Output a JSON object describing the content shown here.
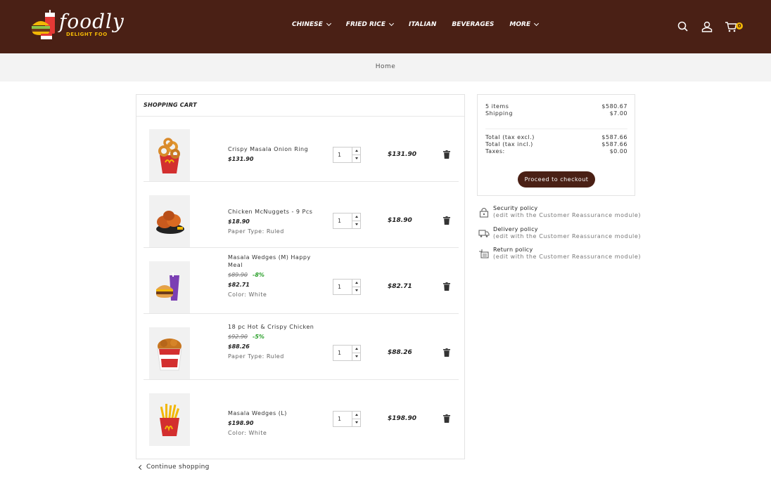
{
  "header": {
    "logo_text": "foodly",
    "logo_sub": "DELIGHT FOO",
    "nav": [
      {
        "label": "CHINESE",
        "has_dropdown": true
      },
      {
        "label": "FRIED RICE",
        "has_dropdown": true
      },
      {
        "label": "ITALIAN",
        "has_dropdown": false
      },
      {
        "label": "BEVERAGES",
        "has_dropdown": false
      },
      {
        "label": "MORE",
        "has_dropdown": true
      }
    ],
    "cart_count": "0",
    "icons": [
      "search-icon",
      "user-icon",
      "cart-icon"
    ]
  },
  "breadcrumb": {
    "home": "Home"
  },
  "cart": {
    "title": "SHOPPING CART",
    "items": [
      {
        "name": "Crispy Masala Onion Ring",
        "price": "$131.90",
        "old_price": "",
        "discount": "",
        "attribute": "",
        "qty": "1",
        "total": "$131.90",
        "image": "onion-rings"
      },
      {
        "name": "Chicken McNuggets - 9 Pcs",
        "price": "$18.90",
        "old_price": "",
        "discount": "",
        "attribute": "Paper Type: Ruled",
        "qty": "1",
        "total": "$18.90",
        "image": "chicken"
      },
      {
        "name": "Masala Wedges (M) Happy Meal",
        "price": "$82.71",
        "old_price": "$89.90",
        "discount": "-8%",
        "attribute": "Color: White",
        "qty": "1",
        "total": "$82.71",
        "image": "burger-meal"
      },
      {
        "name": "18 pc Hot & Crispy Chicken",
        "price": "$88.26",
        "old_price": "$92.90",
        "discount": "-5%",
        "attribute": "Paper Type: Ruled",
        "qty": "1",
        "total": "$88.26",
        "image": "chicken-bucket"
      },
      {
        "name": "Masala Wedges (L)",
        "price": "$198.90",
        "old_price": "",
        "discount": "",
        "attribute": "Color: White",
        "qty": "1",
        "total": "$198.90",
        "image": "fries"
      }
    ],
    "continue_label": "Continue shopping"
  },
  "summary": {
    "items_label": "5 items",
    "items_value": "$580.67",
    "shipping_label": "Shipping",
    "shipping_value": "$7.00",
    "total_excl_label": "Total (tax excl.)",
    "total_excl_value": "$587.66",
    "total_incl_label": "Total (tax incl.)",
    "total_incl_value": "$587.66",
    "taxes_label": "Taxes:",
    "taxes_value": "$0.00",
    "checkout_label": "Proceed to checkout"
  },
  "reassurance": [
    {
      "title": "Security policy",
      "sub": "(edit with the Customer Reassurance module)",
      "icon": "lock-icon"
    },
    {
      "title": "Delivery policy",
      "sub": "(edit with the Customer Reassurance module)",
      "icon": "truck-icon"
    },
    {
      "title": "Return policy",
      "sub": "(edit with the Customer Reassurance module)",
      "icon": "return-icon"
    }
  ],
  "colors": {
    "header_bg": "#4a2015",
    "accent": "#f2b705",
    "discount": "#2ba02b"
  }
}
